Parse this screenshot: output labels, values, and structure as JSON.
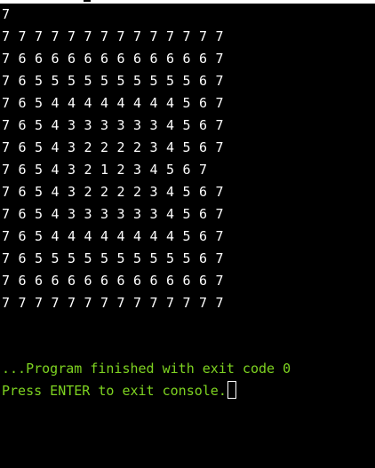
{
  "console": {
    "input_echo": "7",
    "output_rows": [
      [
        "7",
        "7",
        "7",
        "7",
        "7",
        "7",
        "7",
        "7",
        "7",
        "7",
        "7",
        "7",
        "7",
        "7"
      ],
      [
        "7",
        "6",
        "6",
        "6",
        "6",
        "6",
        "6",
        "6",
        "6",
        "6",
        "6",
        "6",
        "6",
        "7"
      ],
      [
        "7",
        "6",
        "5",
        "5",
        "5",
        "5",
        "5",
        "5",
        "5",
        "5",
        "5",
        "5",
        "6",
        "7"
      ],
      [
        "7",
        "6",
        "5",
        "4",
        "4",
        "4",
        "4",
        "4",
        "4",
        "4",
        "4",
        "5",
        "6",
        "7"
      ],
      [
        "7",
        "6",
        "5",
        "4",
        "3",
        "3",
        "3",
        "3",
        "3",
        "3",
        "4",
        "5",
        "6",
        "7"
      ],
      [
        "7",
        "6",
        "5",
        "4",
        "3",
        "2",
        "2",
        "2",
        "2",
        "3",
        "4",
        "5",
        "6",
        "7"
      ],
      [
        "7",
        "6",
        "5",
        "4",
        "3",
        "2",
        "1",
        "2",
        "3",
        "4",
        "5",
        "6",
        "7"
      ],
      [
        "7",
        "6",
        "5",
        "4",
        "3",
        "2",
        "2",
        "2",
        "2",
        "3",
        "4",
        "5",
        "6",
        "7"
      ],
      [
        "7",
        "6",
        "5",
        "4",
        "3",
        "3",
        "3",
        "3",
        "3",
        "3",
        "4",
        "5",
        "6",
        "7"
      ],
      [
        "7",
        "6",
        "5",
        "4",
        "4",
        "4",
        "4",
        "4",
        "4",
        "4",
        "4",
        "5",
        "6",
        "7"
      ],
      [
        "7",
        "6",
        "5",
        "5",
        "5",
        "5",
        "5",
        "5",
        "5",
        "5",
        "5",
        "5",
        "6",
        "7"
      ],
      [
        "7",
        "6",
        "6",
        "6",
        "6",
        "6",
        "6",
        "6",
        "6",
        "6",
        "6",
        "6",
        "6",
        "7"
      ],
      [
        "7",
        "7",
        "7",
        "7",
        "7",
        "7",
        "7",
        "7",
        "7",
        "7",
        "7",
        "7",
        "7",
        "7"
      ]
    ],
    "finish_message": "...Program finished with exit code 0",
    "exit_prompt": "Press ENTER to exit console."
  },
  "colors": {
    "background": "#000000",
    "output_text": "#ffffff",
    "status_text": "#7ed321"
  }
}
